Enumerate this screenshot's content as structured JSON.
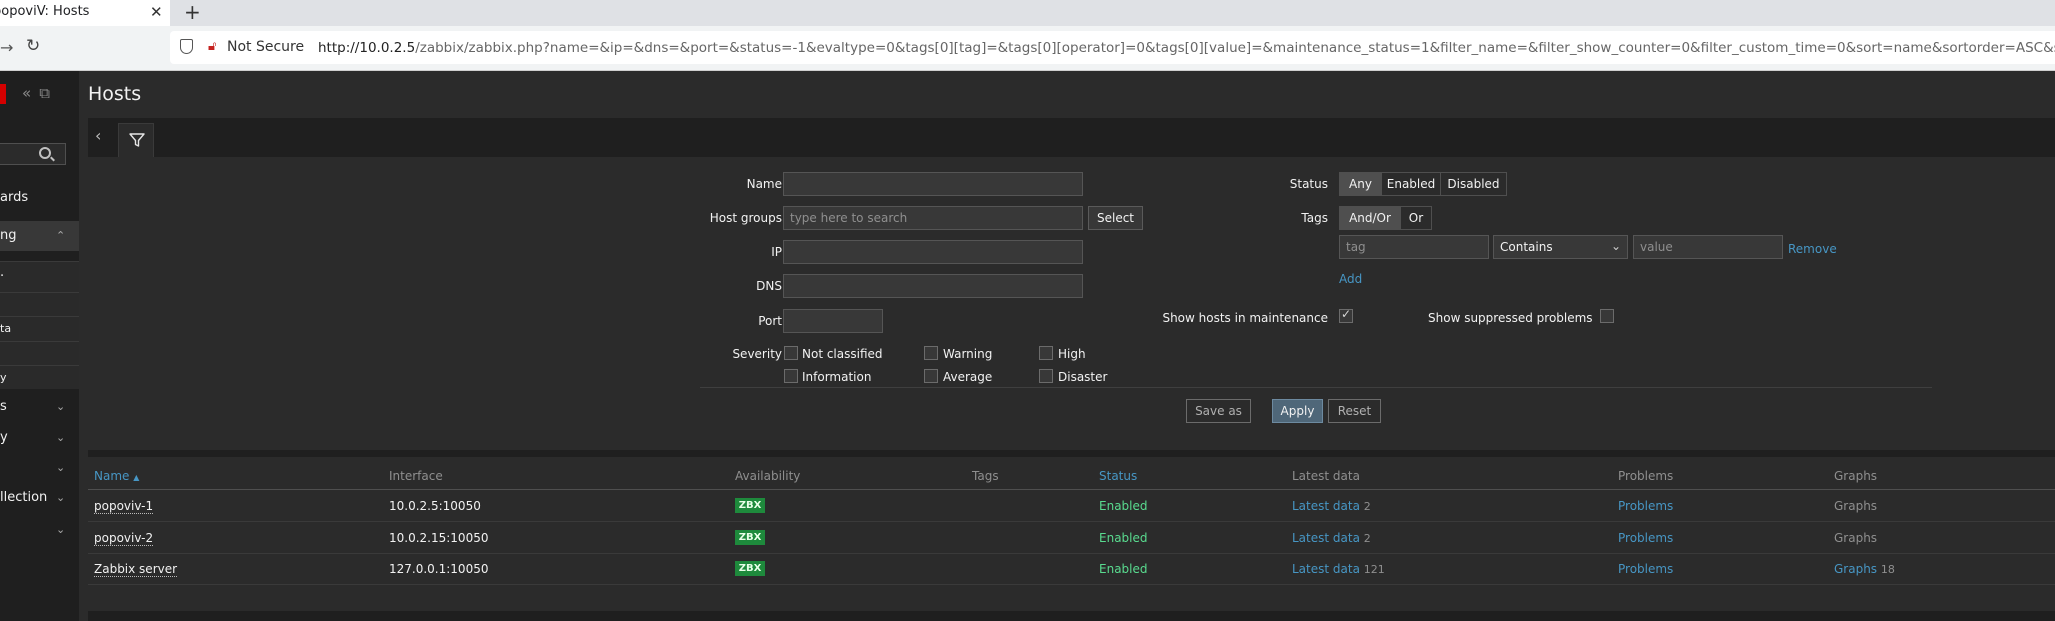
{
  "browser": {
    "tab_title": "popoviV: Hosts",
    "tab_close": "✕",
    "new_tab": "+",
    "not_secure": "Not Secure",
    "url_host": "http://10.0.2.5",
    "url_rest": "/zabbix/zabbix.php?name=&ip=&dns=&port=&status=-1&evaltype=0&tags[0][tag]=&tags[0][operator]=0&tags[0][value]=&maintenance_status=1&filter_name=&filter_show_counter=0&filter_custom_time=0&sort=name&sortorder=ASC&sh"
  },
  "sidebar": {
    "items": [
      {
        "label": "ards"
      },
      {
        "label": "ng"
      },
      {
        "label": "ta"
      },
      {
        "label": "y"
      },
      {
        "label": "s"
      },
      {
        "label": "y"
      },
      {
        "label": "llection"
      }
    ]
  },
  "page": {
    "title": "Hosts"
  },
  "filter": {
    "name_label": "Name",
    "name_value": "",
    "host_groups_label": "Host groups",
    "host_groups_placeholder": "type here to search",
    "select_button": "Select",
    "ip_label": "IP",
    "dns_label": "DNS",
    "port_label": "Port",
    "severity_label": "Severity",
    "severities": [
      "Not classified",
      "Warning",
      "High",
      "Information",
      "Average",
      "Disaster"
    ],
    "status_label": "Status",
    "status_options": [
      "Any",
      "Enabled",
      "Disabled"
    ],
    "status_selected": "Any",
    "tags_label": "Tags",
    "tags_options": [
      "And/Or",
      "Or"
    ],
    "tags_selected": "And/Or",
    "tag_placeholder": "tag",
    "operator_value": "Contains",
    "value_placeholder": "value",
    "remove_link": "Remove",
    "add_link": "Add",
    "show_maintenance_label": "Show hosts in maintenance",
    "show_maintenance_checked": true,
    "show_suppressed_label": "Show suppressed problems",
    "show_suppressed_checked": false,
    "save_as_button": "Save as",
    "apply_button": "Apply",
    "reset_button": "Reset"
  },
  "table": {
    "headers": {
      "name": "Name",
      "sort_arrow": "▲",
      "interface": "Interface",
      "availability": "Availability",
      "tags": "Tags",
      "status": "Status",
      "latest_data": "Latest data",
      "problems": "Problems",
      "graphs": "Graphs"
    },
    "rows": [
      {
        "name": "popoviv-1",
        "interface": "10.0.2.5:10050",
        "availability": "ZBX",
        "status": "Enabled",
        "latest_data": "Latest data",
        "latest_count": "2",
        "problems": "Problems",
        "graphs": "Graphs",
        "graphs_count": ""
      },
      {
        "name": "popoviv-2",
        "interface": "10.0.2.15:10050",
        "availability": "ZBX",
        "status": "Enabled",
        "latest_data": "Latest data",
        "latest_count": "2",
        "problems": "Problems",
        "graphs": "Graphs",
        "graphs_count": ""
      },
      {
        "name": "Zabbix server",
        "interface": "127.0.0.1:10050",
        "availability": "ZBX",
        "status": "Enabled",
        "latest_data": "Latest data",
        "latest_count": "121",
        "problems": "Problems",
        "graphs": "Graphs",
        "graphs_count": "18"
      }
    ]
  },
  "colors": {
    "accent_link": "#4796c4",
    "enabled_green": "#59db8f",
    "zbx_badge": "#1e8a3c",
    "apply_button": "#4f6779",
    "logo_red": "#d40000"
  }
}
